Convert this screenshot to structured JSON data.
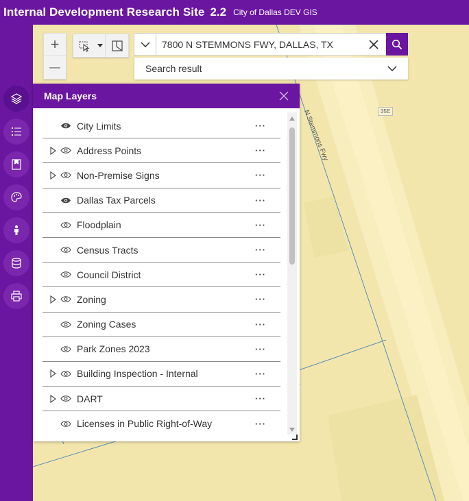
{
  "header": {
    "title": "Internal Development Research Site",
    "version": "2.2",
    "subtitle": "City of Dallas DEV GIS"
  },
  "sidebar": {
    "items": [
      {
        "name": "layers",
        "icon": "layers-icon",
        "active": true
      },
      {
        "name": "legend",
        "icon": "list-icon",
        "active": false
      },
      {
        "name": "bookmarks",
        "icon": "bookmark-icon",
        "active": false
      },
      {
        "name": "basemap",
        "icon": "palette-icon",
        "active": false
      },
      {
        "name": "streetview",
        "icon": "pegman-icon",
        "active": false
      },
      {
        "name": "data",
        "icon": "database-icon",
        "active": false
      },
      {
        "name": "print",
        "icon": "print-icon",
        "active": false
      }
    ]
  },
  "zoom": {
    "in": "+",
    "out": "—"
  },
  "search": {
    "value": "7800 N STEMMONS FWY, DALLAS, TX",
    "result_label": "Search result"
  },
  "map": {
    "road_label": "N Stemmons Fwy",
    "shield_label": "35E"
  },
  "layers_panel": {
    "title": "Map Layers",
    "more_label": "···",
    "layers": [
      {
        "name": "City Limits",
        "expandable": false,
        "visible": true
      },
      {
        "name": "Address Points",
        "expandable": true,
        "visible": false
      },
      {
        "name": "Non-Premise Signs",
        "expandable": true,
        "visible": false
      },
      {
        "name": "Dallas Tax Parcels",
        "expandable": false,
        "visible": true
      },
      {
        "name": "Floodplain",
        "expandable": false,
        "visible": false
      },
      {
        "name": "Census Tracts",
        "expandable": false,
        "visible": false
      },
      {
        "name": "Council District",
        "expandable": false,
        "visible": false
      },
      {
        "name": "Zoning",
        "expandable": true,
        "visible": false
      },
      {
        "name": "Zoning Cases",
        "expandable": false,
        "visible": false
      },
      {
        "name": "Park Zones 2023",
        "expandable": false,
        "visible": false
      },
      {
        "name": "Building Inspection - Internal",
        "expandable": true,
        "visible": false
      },
      {
        "name": "DART",
        "expandable": true,
        "visible": false
      },
      {
        "name": "Licenses in Public Right-of-Way",
        "expandable": false,
        "visible": false
      }
    ]
  },
  "colors": {
    "brand": "#6a16a0",
    "map_bg": "#f3e6ad",
    "parcel_line": "#5b8fb5"
  }
}
